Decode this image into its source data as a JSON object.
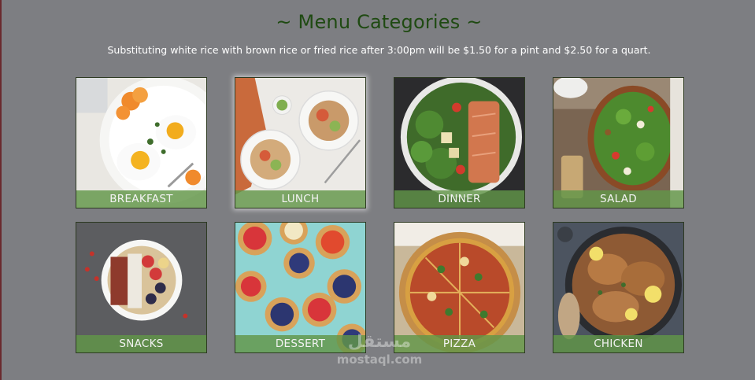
{
  "header": {
    "title": "~ Menu Categories ~",
    "subtitle": "Substituting white rice with brown rice or fried rice after 3:00pm will be $1.50 for a pint and $2.50 for a quart."
  },
  "categories": [
    {
      "label": "BREAKFAST",
      "photo": "eggs-and-orange-plate"
    },
    {
      "label": "LUNCH",
      "photo": "salad-bowls-table"
    },
    {
      "label": "DINNER",
      "photo": "salmon-with-vegetables"
    },
    {
      "label": "SALAD",
      "photo": "apple-salad-bowl"
    },
    {
      "label": "SNACKS",
      "photo": "yogurt-berry-bowl"
    },
    {
      "label": "DESSERT",
      "photo": "fruit-tarts"
    },
    {
      "label": "PIZZA",
      "photo": "sliced-pizza"
    },
    {
      "label": "CHICKEN",
      "photo": "lemon-chicken-skillet"
    }
  ],
  "watermark": {
    "arabic": "مستقل",
    "latin": "mostaql.com"
  },
  "colors": {
    "background": "#7d7e82",
    "title": "#1f4a12",
    "label_bar": "#629648"
  }
}
